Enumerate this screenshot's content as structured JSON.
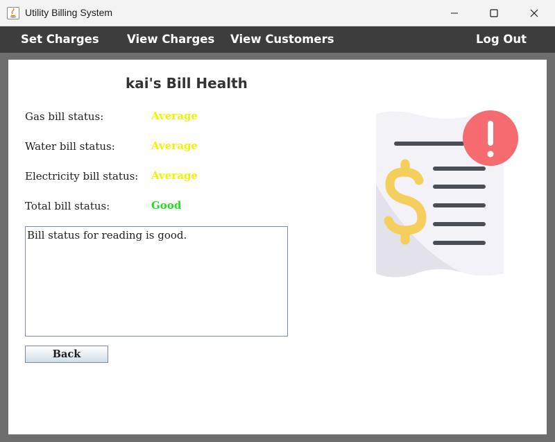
{
  "window": {
    "title": "Utility Billing System",
    "controls": [
      "minimize",
      "maximize",
      "close"
    ]
  },
  "menu": {
    "set_charges": "Set Charges",
    "view_charges": "View Charges",
    "view_customers": "View Customers",
    "log_out": "Log Out"
  },
  "page": {
    "heading": "kai's Bill Health",
    "rows": [
      {
        "label": "Gas bill status:",
        "value": "Average",
        "color": "#f2f200"
      },
      {
        "label": "Water bill status:",
        "value": "Average",
        "color": "#f2f200"
      },
      {
        "label": "Electricity bill status:",
        "value": "Average",
        "color": "#f2f200"
      },
      {
        "label": "Total bill status:",
        "value": "Good",
        "color": "#1ee01e"
      }
    ],
    "message": "Bill status for reading is good.",
    "back_label": "Back"
  },
  "illustration": {
    "icon": "bill-alert-icon",
    "colors": {
      "paper": "#f3f2f8",
      "shadow": "#e3e1ea",
      "lines": "#4a4d55",
      "dollar": "#f5cf5c",
      "alert": "#f56b6f"
    }
  }
}
